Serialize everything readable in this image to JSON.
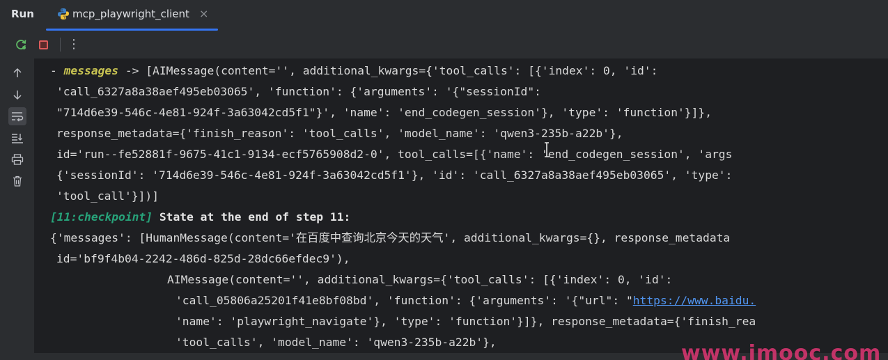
{
  "header": {
    "run_label": "Run",
    "tab_label": "mcp_playwright_client",
    "tab_close": "×"
  },
  "toolbar": {
    "more_label": "⋮"
  },
  "console": {
    "l1_prefix": "- ",
    "l1_key": "messages",
    "l1_rest": " -> [AIMessage(content='', additional_kwargs={'tool_calls': [{'index': 0, 'id':",
    "l2": "'call_6327a8a38aef495eb03065', 'function': {'arguments': '{\"sessionId\":",
    "l3": "\"714d6e39-546c-4e81-924f-3a63042cd5f1\"}', 'name': 'end_codegen_session'}, 'type': 'function'}]},",
    "l4": "response_metadata={'finish_reason': 'tool_calls', 'model_name': 'qwen3-235b-a22b'},",
    "l5": "id='run--fe52881f-9675-41c1-9134-ecf5765908d2-0', tool_calls=[{'name': 'end_codegen_session', 'args",
    "l6": "{'sessionId': '714d6e39-546c-4e81-924f-3a63042cd5f1'}, 'id': 'call_6327a8a38aef495eb03065', 'type':",
    "l7": "'tool_call'}])]",
    "l8_tag": "[11:checkpoint]",
    "l8_rest": " State at the end of step 11:",
    "l9": "{'messages': [HumanMessage(content='在百度中查询北京今天的天气', additional_kwargs={}, response_metadata",
    "l10": "id='bf9f4b04-2242-486d-825d-28dc66efdec9'),",
    "l11": "AIMessage(content='', additional_kwargs={'tool_calls': [{'index': 0, 'id':",
    "l12_pre": "'call_05806a25201f41e8bf08bd', 'function': {'arguments': '{\"url\": \"",
    "l12_link": "https://www.baidu.",
    "l13": "'name': 'playwright_navigate'}, 'type': 'function'}]}, response_metadata={'finish_rea",
    "l14": "'tool_calls', 'model_name': 'qwen3-235b-a22b'},"
  },
  "watermark": {
    "text": "www.imooc.com"
  }
}
